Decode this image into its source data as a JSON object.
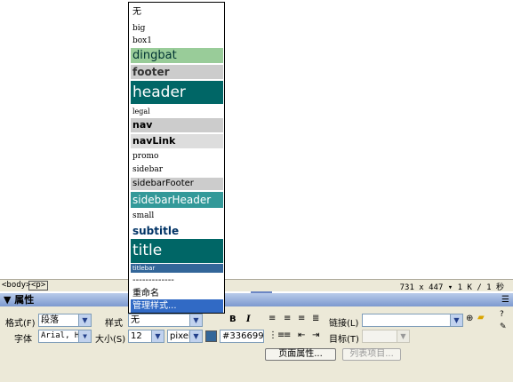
{
  "status_bar": {
    "tag_body": "<body>",
    "tag_p": "<p>",
    "right_info": "731 x 447 ▾ 1 K / 1 秒"
  },
  "panel": {
    "title": "▼ 属性"
  },
  "format": {
    "label": "格式(F)",
    "value": "段落"
  },
  "font": {
    "label": "字体",
    "value": "Arial, He"
  },
  "style": {
    "label": "样式",
    "value": "无"
  },
  "size": {
    "label": "大小(S)",
    "value": "12",
    "unit": "pixel"
  },
  "color": {
    "value": "#336699",
    "swatch": "#336699"
  },
  "bold_label": "B",
  "italic_label": "I",
  "link": {
    "label": "链接(L)",
    "value": ""
  },
  "target": {
    "label": "目标(T)",
    "value": ""
  },
  "page_props_button": "页面属性...",
  "list_items_button": "列表项目...",
  "dropdown": {
    "items": [
      {
        "label": "无"
      },
      {
        "label": "big"
      },
      {
        "label": "box1"
      },
      {
        "label": "dingbat",
        "bg": "#99cc99",
        "color": "#003333"
      },
      {
        "label": "footer",
        "bg": "#cccccc",
        "color": "#333333"
      },
      {
        "label": "header",
        "bg": "#006666",
        "color": "#ffffff"
      },
      {
        "label": "legal"
      },
      {
        "label": "nav",
        "bg": "#cccccc",
        "color": "#000000"
      },
      {
        "label": "navLink",
        "bg": "#dddddd",
        "color": "#000000"
      },
      {
        "label": "promo"
      },
      {
        "label": "sidebar"
      },
      {
        "label": "sidebarFooter",
        "bg": "#cccccc",
        "color": "#000000"
      },
      {
        "label": "sidebarHeader",
        "bg": "#339999",
        "color": "#ffffff"
      },
      {
        "label": "small"
      },
      {
        "label": "subtitle",
        "color": "#003366"
      },
      {
        "label": "title",
        "bg": "#006666",
        "color": "#ffffff"
      },
      {
        "label": "titlebar",
        "bg": "#336699",
        "color": "#ffffff"
      },
      {
        "label": "-------------"
      },
      {
        "label": "重命名"
      },
      {
        "label": "管理样式...",
        "bg": "#316ac5",
        "color": "#ffffff"
      }
    ]
  }
}
